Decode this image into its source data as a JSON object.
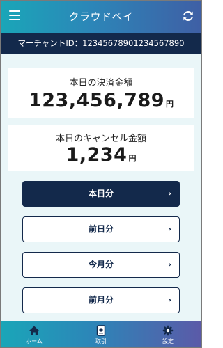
{
  "header": {
    "title": "クラウドペイ",
    "menu_icon": "hamburger-menu-icon",
    "refresh_icon": "refresh-icon"
  },
  "merchant": {
    "label": "マーチャントID：12345678901234567890"
  },
  "today_sales": {
    "label": "本日の決済金額",
    "amount": "123,456,789",
    "unit": "円"
  },
  "today_cancel": {
    "label": "本日のキャンセル金額",
    "amount": "1,234",
    "unit": "円"
  },
  "period_buttons": [
    {
      "label": "本日分",
      "selected": true
    },
    {
      "label": "前日分",
      "selected": false
    },
    {
      "label": "今月分",
      "selected": false
    },
    {
      "label": "前月分",
      "selected": false
    }
  ],
  "chevron": "›",
  "tabs": [
    {
      "label": "ホーム",
      "icon": "home-icon"
    },
    {
      "label": "取引",
      "icon": "transaction-icon"
    },
    {
      "label": "設定",
      "icon": "gear-icon"
    }
  ],
  "colors": {
    "navy": "#13294b",
    "teal": "#1aa6b8",
    "background": "#eaf6f8"
  }
}
